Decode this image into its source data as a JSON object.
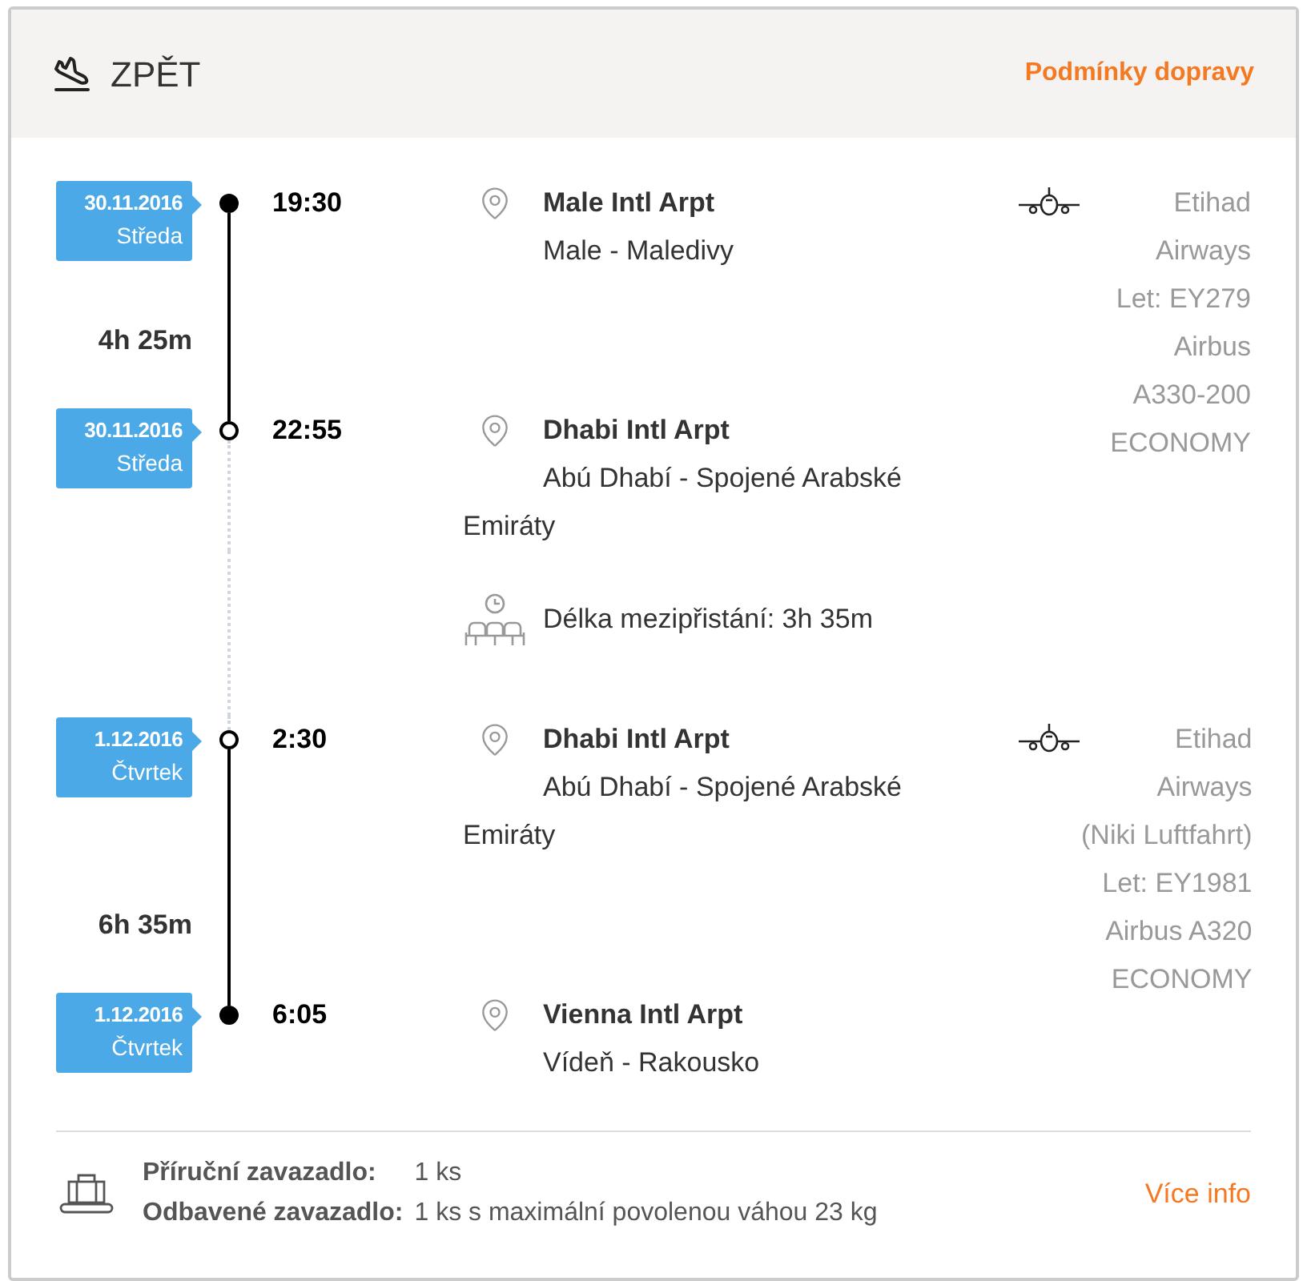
{
  "header": {
    "title": "ZPĚT",
    "link": "Podmínky dopravy"
  },
  "itinerary": [
    {
      "kind": "flight",
      "departure": {
        "date": "30.11.2016",
        "day": "Středa",
        "time": "19:30",
        "airport": "Male Intl Arpt",
        "city": "Male - Maledivy",
        "transfer": false
      },
      "duration": "4h 25m",
      "arrival": {
        "date": "30.11.2016",
        "day": "Středa",
        "time": "22:55",
        "airport": "Dhabi Intl Arpt",
        "city": "Abú Dhabí - Spojené Arabské Emiráty",
        "transfer": true
      },
      "carrier": [
        "Etihad",
        "Airways",
        "Let: EY279",
        "Airbus",
        "A330-200",
        "ECONOMY"
      ]
    },
    {
      "kind": "layover",
      "text": "Délka mezipřistání: 3h 35m"
    },
    {
      "kind": "flight",
      "departure": {
        "date": "1.12.2016",
        "day": "Čtvrtek",
        "time": "2:30",
        "airport": "Dhabi Intl Arpt",
        "city": "Abú Dhabí - Spojené Arabské Emiráty",
        "transfer": true
      },
      "duration": "6h 35m",
      "arrival": {
        "date": "1.12.2016",
        "day": "Čtvrtek",
        "time": "6:05",
        "airport": "Vienna Intl Arpt",
        "city": "Vídeň - Rakousko",
        "transfer": false
      },
      "carrier": [
        "Etihad",
        "Airways",
        "(Niki Luftfahrt)",
        "Let: EY1981",
        "Airbus A320",
        "ECONOMY"
      ]
    }
  ],
  "baggage": [
    {
      "label": "Příruční zavazadlo:",
      "value": "1 ks"
    },
    {
      "label": "Odbavené zavazadlo:",
      "value": "1 ks s maximální povolenou váhou 23 kg"
    }
  ],
  "more_info": "Více info"
}
